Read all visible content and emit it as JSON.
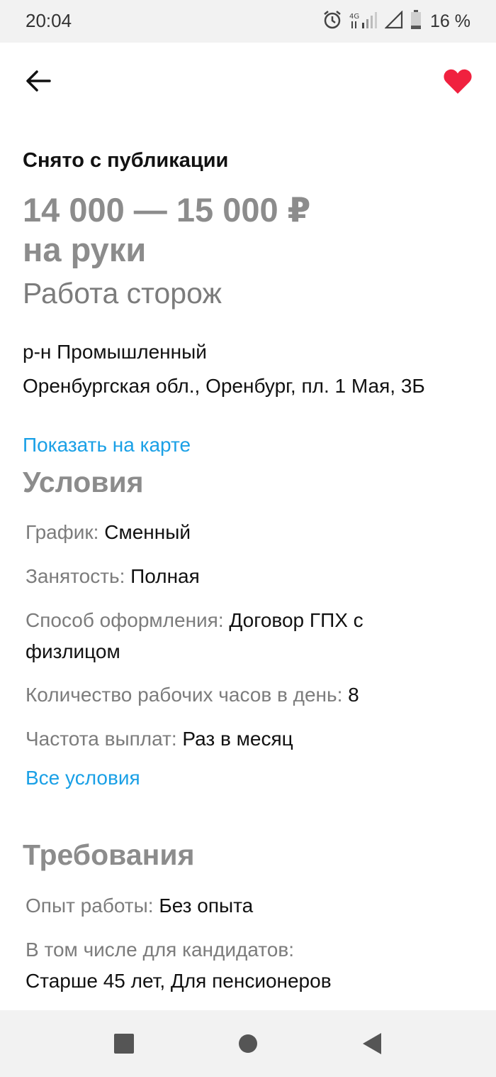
{
  "status_bar": {
    "time": "20:04",
    "battery": "16 %",
    "icons": [
      "alarm-icon",
      "network-4g-icon",
      "signal-icon",
      "battery-icon"
    ]
  },
  "header": {
    "back_icon": "arrow-left-icon",
    "favorite_icon": "heart-icon",
    "favorite_color": "#f0213f"
  },
  "vacancy": {
    "status": "Снято с публикации",
    "salary_line1": "14 000 — 15 000 ₽",
    "salary_line2": "на руки",
    "title": "Работа сторож",
    "address_line1": "р-н Промышленный",
    "address_line2": "Оренбургская обл., Оренбург, пл. 1 Мая, 3Б",
    "map_link": "Показать на карте"
  },
  "conditions": {
    "title": "Условия",
    "items": [
      {
        "key": "График:",
        "value": "Сменный"
      },
      {
        "key": "Занятость:",
        "value": "Полная"
      },
      {
        "key": "Способ оформления:",
        "value": "Договор ГПХ с физлицом"
      },
      {
        "key": "Количество рабочих часов в день:",
        "value": "8"
      },
      {
        "key": "Частота выплат:",
        "value": "Раз в месяц"
      }
    ],
    "all_link": "Все условия"
  },
  "requirements": {
    "title": "Требования",
    "items": [
      {
        "key": "Опыт работы:",
        "value": "Без опыта"
      },
      {
        "key": "В том числе для кандидатов:",
        "value": "Старше 45 лет, Для пенсионеров"
      }
    ]
  },
  "colors": {
    "link": "#1aa0e6",
    "muted": "#8c8c8c",
    "accent": "#f0213f"
  },
  "nav_bar": {
    "icons": [
      "recent-apps-icon",
      "home-icon",
      "back-triangle-icon"
    ]
  }
}
